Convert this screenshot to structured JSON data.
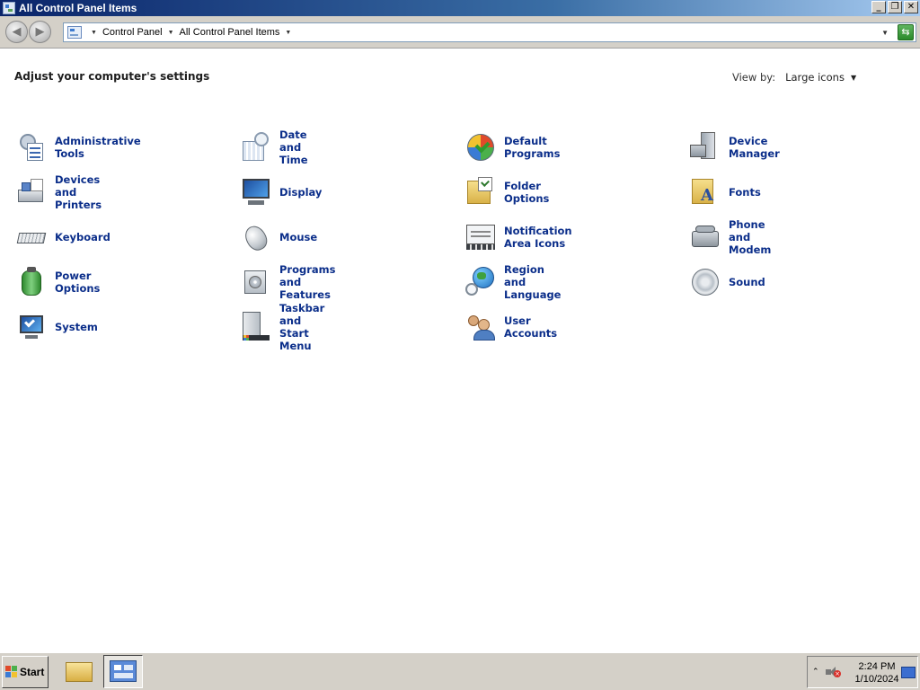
{
  "window": {
    "title": "All Control Panel Items",
    "controls": {
      "minimize": "_",
      "maximize": "❐",
      "close": "✕"
    }
  },
  "address_bar": {
    "crumbs": [
      "Control Panel",
      "All Control Panel Items"
    ]
  },
  "content": {
    "heading": "Adjust your computer's settings",
    "view_by_label": "View by:",
    "view_by_value": "Large icons"
  },
  "items": [
    {
      "label": "Administrative Tools",
      "icon": "admin-tools-icon"
    },
    {
      "label": "Date and Time",
      "icon": "clock-calendar-icon"
    },
    {
      "label": "Default Programs",
      "icon": "default-programs-icon"
    },
    {
      "label": "Device Manager",
      "icon": "device-manager-icon"
    },
    {
      "label": "Devices and Printers",
      "icon": "printer-icon"
    },
    {
      "label": "Display",
      "icon": "monitor-icon"
    },
    {
      "label": "Folder Options",
      "icon": "folder-options-icon"
    },
    {
      "label": "Fonts",
      "icon": "fonts-folder-icon"
    },
    {
      "label": "Keyboard",
      "icon": "keyboard-icon"
    },
    {
      "label": "Mouse",
      "icon": "mouse-icon"
    },
    {
      "label": "Notification Area Icons",
      "icon": "notification-icons-icon"
    },
    {
      "label": "Phone and Modem",
      "icon": "phone-icon"
    },
    {
      "label": "Power Options",
      "icon": "battery-icon"
    },
    {
      "label": "Programs and Features",
      "icon": "programs-icon"
    },
    {
      "label": "Region and Language",
      "icon": "globe-clock-icon"
    },
    {
      "label": "Sound",
      "icon": "speaker-icon"
    },
    {
      "label": "System",
      "icon": "system-icon"
    },
    {
      "label": "Taskbar and Start Menu",
      "icon": "taskbar-icon"
    },
    {
      "label": "User Accounts",
      "icon": "users-icon"
    }
  ],
  "taskbar": {
    "start_label": "Start",
    "time": "2:24 PM",
    "date": "1/10/2024"
  },
  "colors": {
    "link": "#0b2e8a",
    "title_bar": "#0a246a",
    "chrome": "#d4d0c8"
  }
}
